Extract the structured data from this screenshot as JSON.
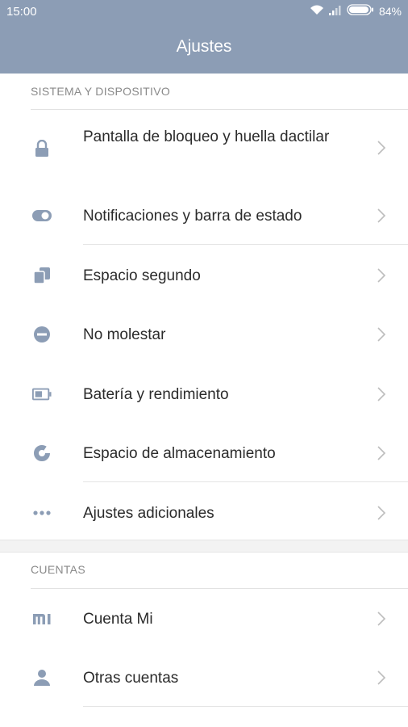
{
  "status_bar": {
    "time": "15:00",
    "battery": "84%",
    "icons": [
      "wifi-icon",
      "signal-icon",
      "battery-icon"
    ]
  },
  "header": {
    "title": "Ajustes"
  },
  "sections": [
    {
      "label": "SISTEMA Y DISPOSITIVO",
      "items": [
        {
          "label": "Pantalla de bloqueo y huella dactilar",
          "icon": "lock-icon"
        },
        {
          "label": "Notificaciones y barra de estado",
          "icon": "toggle-icon"
        },
        {
          "label": "Espacio segundo",
          "icon": "second-space-icon"
        },
        {
          "label": "No molestar",
          "icon": "do-not-disturb-icon"
        },
        {
          "label": "Batería y rendimiento",
          "icon": "battery-performance-icon"
        },
        {
          "label": "Espacio de almacenamiento",
          "icon": "storage-icon"
        },
        {
          "label": "Ajustes adicionales",
          "icon": "more-icon"
        }
      ]
    },
    {
      "label": "CUENTAS",
      "items": [
        {
          "label": "Cuenta Mi",
          "icon": "mi-account-icon"
        },
        {
          "label": "Otras cuentas",
          "icon": "person-icon"
        }
      ]
    }
  ],
  "colors": {
    "header": "#8c9db5",
    "icon": "#8c9db5",
    "text": "#2b2b2b",
    "section_label": "#8a8a8a",
    "chevron": "#bdbdbd"
  }
}
